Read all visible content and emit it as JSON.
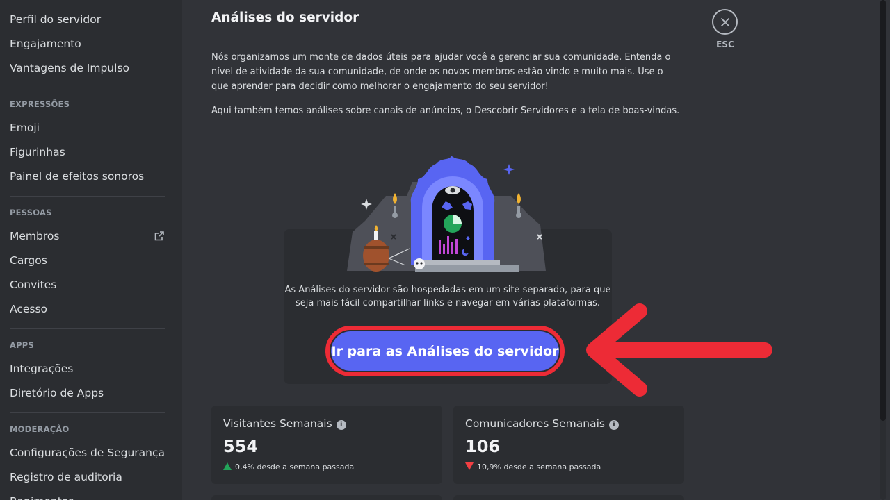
{
  "sidebar": {
    "items_top": [
      "Perfil do servidor",
      "Engajamento",
      "Vantagens de Impulso"
    ],
    "sections": [
      {
        "header": "EXPRESSÕES",
        "items": [
          "Emoji",
          "Figurinhas",
          "Painel de efeitos sonoros"
        ]
      },
      {
        "header": "PESSOAS",
        "items": [
          "Membros",
          "Cargos",
          "Convites",
          "Acesso"
        ]
      },
      {
        "header": "APPS",
        "items": [
          "Integrações",
          "Diretório de Apps"
        ]
      },
      {
        "header": "MODERAÇÃO",
        "items": [
          "Configurações de Segurança",
          "Registro de auditoria",
          "Banimentos"
        ]
      }
    ]
  },
  "main": {
    "title": "Análises do servidor",
    "description": "Nós organizamos um monte de dados úteis para ajudar você a gerenciar sua comunidade. Entenda o nível de atividade da sua comunidade, de onde os novos membros estão vindo e muito mais. Use o que aprender para decidir como melhorar o engajamento do seu servidor!",
    "description2": "Aqui também temos análises sobre canais de anúncios, o Descobrir Servidores e a tela de boas-vindas.",
    "close_label": "ESC",
    "promo_text": "As Análises do servidor são hospedadas em um site separado, para que seja mais fácil compartilhar links e navegar em várias plataformas.",
    "cta_label": "Ir para as Análises do servidor",
    "stats": [
      {
        "label": "Visitantes Semanais",
        "value": "554",
        "change": "0,4% desde a semana passada",
        "direction": "up"
      },
      {
        "label": "Comunicadores Semanais",
        "value": "106",
        "change": "10,9% desde a semana passada",
        "direction": "down"
      }
    ]
  },
  "colors": {
    "accent": "#5865f2",
    "highlight": "#ed2b36",
    "positive": "#23a55a",
    "negative": "#f23f43"
  }
}
